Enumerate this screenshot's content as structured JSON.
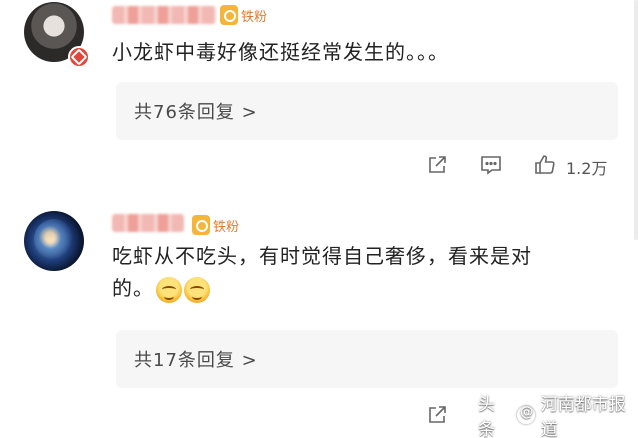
{
  "comments": [
    {
      "user_badge": "铁粉",
      "text": "小龙虾中毒好像还挺经常发生的。。。",
      "replies_label": "共76条回复 >",
      "like_count": "1.2万"
    },
    {
      "user_badge": "铁粉",
      "text": "吃虾从不吃头，有时觉得自己奢侈，看来是对的。",
      "replies_label": "共17条回复 >"
    }
  ],
  "watermark": {
    "label": "头条",
    "account": "河南都市报道"
  },
  "colors": {
    "badge_orange": "#f5b53b",
    "badge_text": "#e07c36",
    "verified_red": "#e0463b",
    "reply_bg": "#f6f6f6"
  }
}
